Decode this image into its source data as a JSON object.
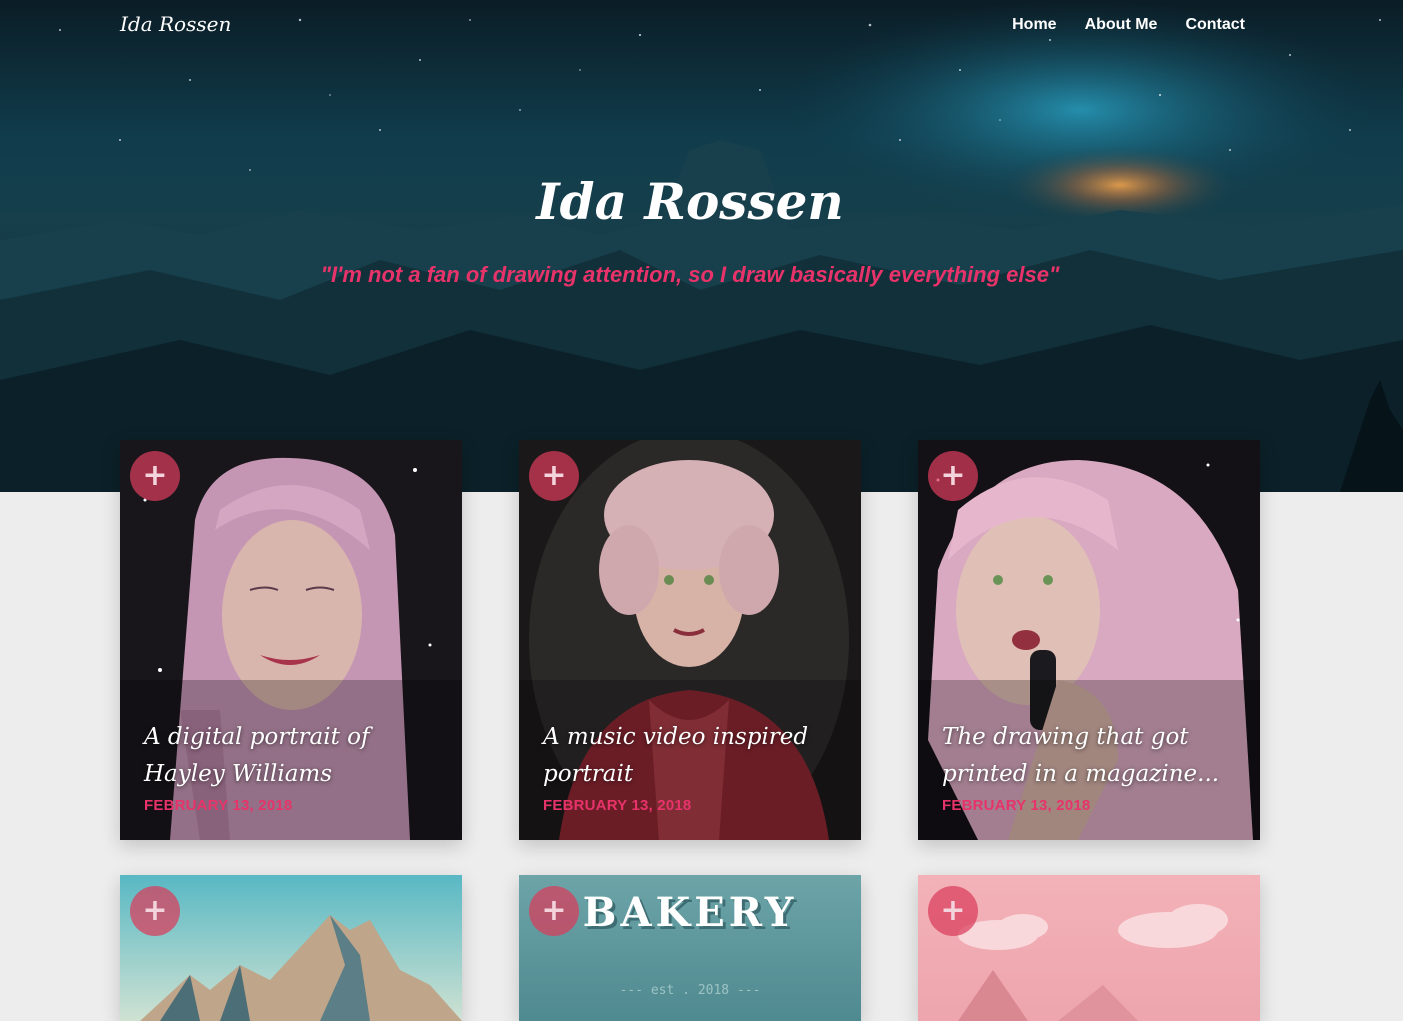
{
  "nav": {
    "brand": "Ida Rossen",
    "links": [
      "Home",
      "About Me",
      "Contact"
    ]
  },
  "hero": {
    "title": "Ida Rossen",
    "quote": "\"I'm not a fan of drawing attention, so I draw basically everything else\""
  },
  "posts": [
    {
      "title": "A digital portrait of Hayley Williams",
      "date": "FEBRUARY 13, 2018"
    },
    {
      "title": "A music video inspired portrait",
      "date": "FEBRUARY 13, 2018"
    },
    {
      "title": "The drawing that got printed in a magazine...",
      "date": "FEBRUARY 13, 2018"
    },
    {
      "title": "",
      "date": ""
    },
    {
      "title": "",
      "date": "",
      "image_text": "BAKERY",
      "image_subtext": "--- est . 2018 ---"
    },
    {
      "title": "",
      "date": ""
    }
  ],
  "icons": {
    "add": "plus-icon"
  },
  "colors": {
    "accent": "#e8336a",
    "background": "#ededed"
  }
}
